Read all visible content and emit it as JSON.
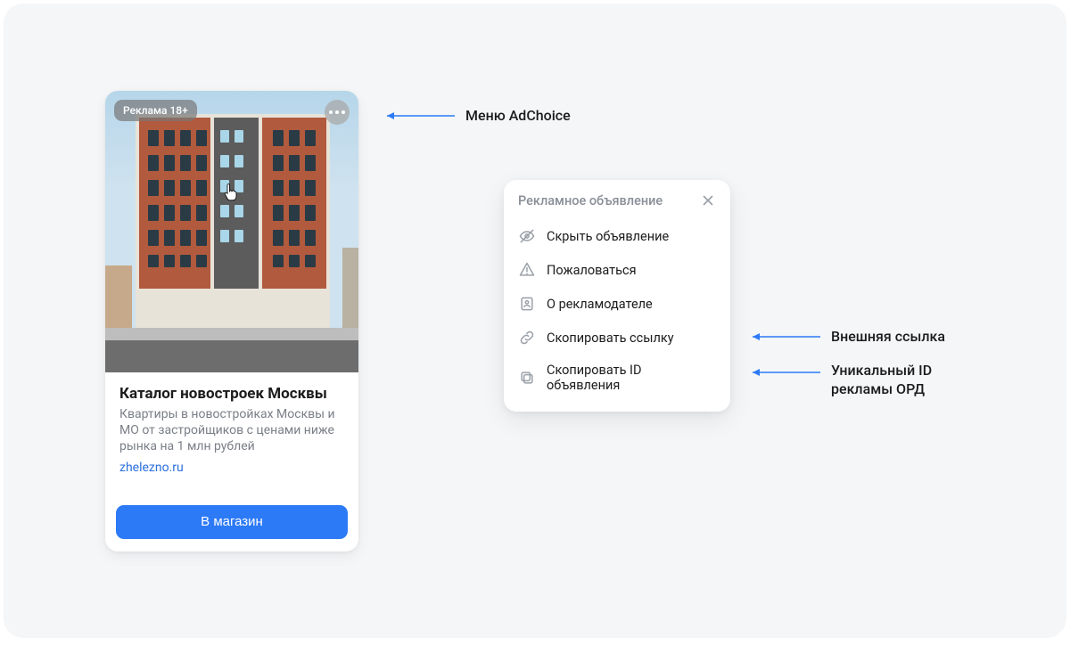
{
  "ad": {
    "badge": "Реклама 18+",
    "title": "Каталог новостроек Москвы",
    "description": "Квартиры в новостройках Москвы и МО от застройщиков с ценами ниже рынка на 1 млн рублей",
    "domain": "zhelezno.ru",
    "cta": "В магазин"
  },
  "menu": {
    "title": "Рекламное объявление",
    "items": [
      {
        "icon": "eye-off",
        "label": "Скрыть объявление"
      },
      {
        "icon": "warning",
        "label": "Пожаловаться"
      },
      {
        "icon": "id-card",
        "label": "О рекламодателе"
      },
      {
        "icon": "link",
        "label": "Скопировать ссылку"
      },
      {
        "icon": "copy",
        "label": "Скопировать ID объявления"
      }
    ]
  },
  "annotations": {
    "adchoice": "Меню AdChoice",
    "external_link": "Внешняя ссылка",
    "unique_id_line1": "Уникальный ID",
    "unique_id_line2": "рекламы ОРД"
  }
}
